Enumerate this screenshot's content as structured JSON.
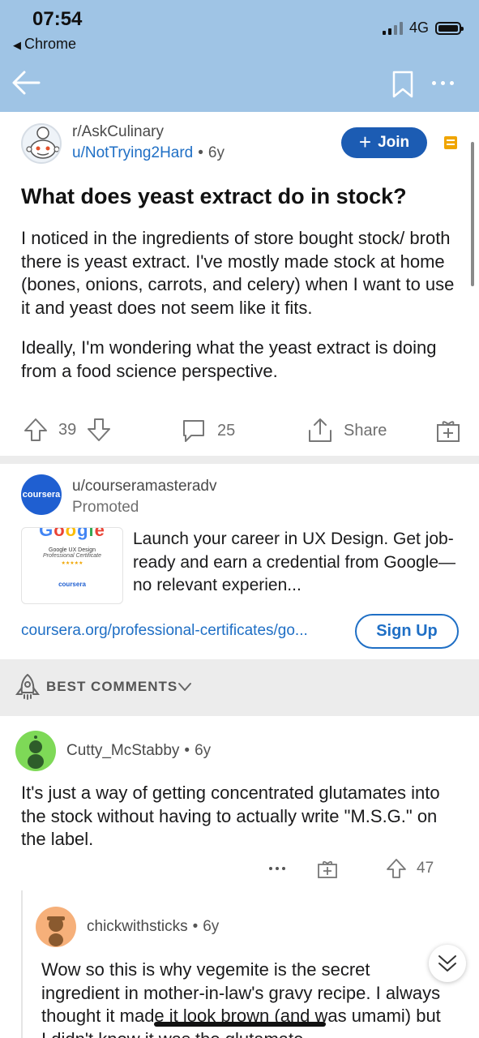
{
  "status_bar": {
    "time": "07:54",
    "back_app": "Chrome",
    "network": "4G"
  },
  "post": {
    "subreddit": "r/AskCulinary",
    "author": "u/NotTrying2Hard",
    "age": "6y",
    "join_label": "Join",
    "title": "What does yeast extract do in stock?",
    "body": [
      "I noticed in the ingredients of store bought stock/ broth there is yeast extract.  I've mostly made stock at home (bones, onions, carrots, and celery) when I want to use it and yeast does not seem like it fits.",
      "Ideally, I'm wondering what the yeast extract is doing from a food science perspective."
    ],
    "votes": "39",
    "comments": "25",
    "share_label": "Share"
  },
  "promo": {
    "avatar_text": "coursera",
    "user": "u/courseramasteradv",
    "tag": "Promoted",
    "thumb_line1": "Google UX Design",
    "thumb_line2": "Professional Certificate",
    "thumb_brand": "coursera",
    "text": "Launch your career in UX Design. Get job-ready and earn a credential from Google—no relevant experien...",
    "link": "coursera.org/professional-certificates/go...",
    "cta": "Sign Up"
  },
  "sort": {
    "label": "BEST COMMENTS"
  },
  "comments": [
    {
      "author": "Cutty_McStabby",
      "age": "6y",
      "body": "It's just a way of getting concentrated glutamates into the stock without having to actually write \"M.S.G.\" on the label.",
      "votes": "47"
    },
    {
      "author": "chickwithsticks",
      "age": "6y",
      "body": "Wow so this is why vegemite is the secret ingredient in mother-in-law's gravy recipe.  I always thought it made it look brown (and was umami) but I didn't know it was the glutamate"
    }
  ],
  "colors": {
    "topbar": "#9fc4e5",
    "link_blue": "#1f6fc5",
    "join_blue": "#1c5cb3",
    "divider": "#ececec"
  },
  "icons": [
    "back-arrow-icon",
    "bookmark-icon",
    "more-icon",
    "mod-shield-icon",
    "upvote-icon",
    "downvote-icon",
    "comment-icon",
    "share-icon",
    "award-icon",
    "rocket-icon",
    "chevron-down-icon"
  ]
}
